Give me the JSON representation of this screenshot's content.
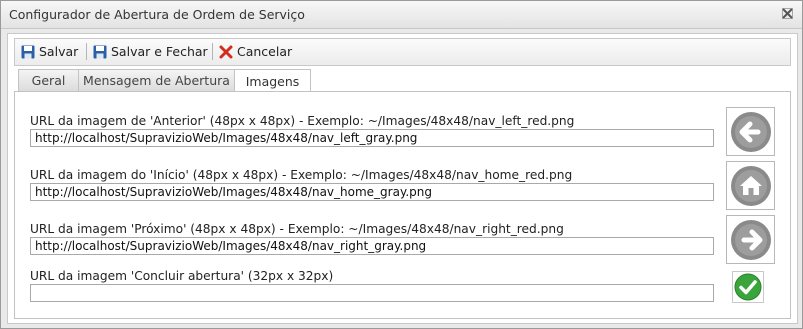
{
  "window": {
    "title": "Configurador de Abertura de Ordem de Serviço",
    "close_icon": "close-icon"
  },
  "toolbar": {
    "save_label": "Salvar",
    "save_close_label": "Salvar e Fechar",
    "cancel_label": "Cancelar"
  },
  "tabs": [
    {
      "label": "Geral"
    },
    {
      "label": "Mensagem de Abertura"
    },
    {
      "label": "Imagens",
      "active": true
    }
  ],
  "fields": [
    {
      "label": "URL da imagem de 'Anterior' (48px x 48px) - Exemplo: ~/Images/48x48/nav_left_red.png",
      "value": "http://localhost/SupravizioWeb/Images/48x48/nav_left_gray.png",
      "preview_icon": "arrow-left-icon"
    },
    {
      "label": "URL da imagem do 'Início' (48px x 48px) - Exemplo: ~/Images/48x48/nav_home_red.png",
      "value": "http://localhost/SupravizioWeb/Images/48x48/nav_home_gray.png",
      "preview_icon": "home-icon"
    },
    {
      "label": "URL da imagem 'Próximo' (48px x 48px) - Exemplo: ~/Images/48x48/nav_right_red.png",
      "value": "http://localhost/SupravizioWeb/Images/48x48/nav_right_gray.png",
      "preview_icon": "arrow-right-icon"
    },
    {
      "label": "URL da imagem 'Concluir abertura' (32px x 32px)",
      "value": "",
      "preview_icon": "checkmark-icon"
    }
  ],
  "colors": {
    "accent_icon_gray": "#8a8a8a",
    "check_green": "#3aa53a",
    "cancel_red": "#d42b1e",
    "save_blue": "#2b5fa8"
  }
}
